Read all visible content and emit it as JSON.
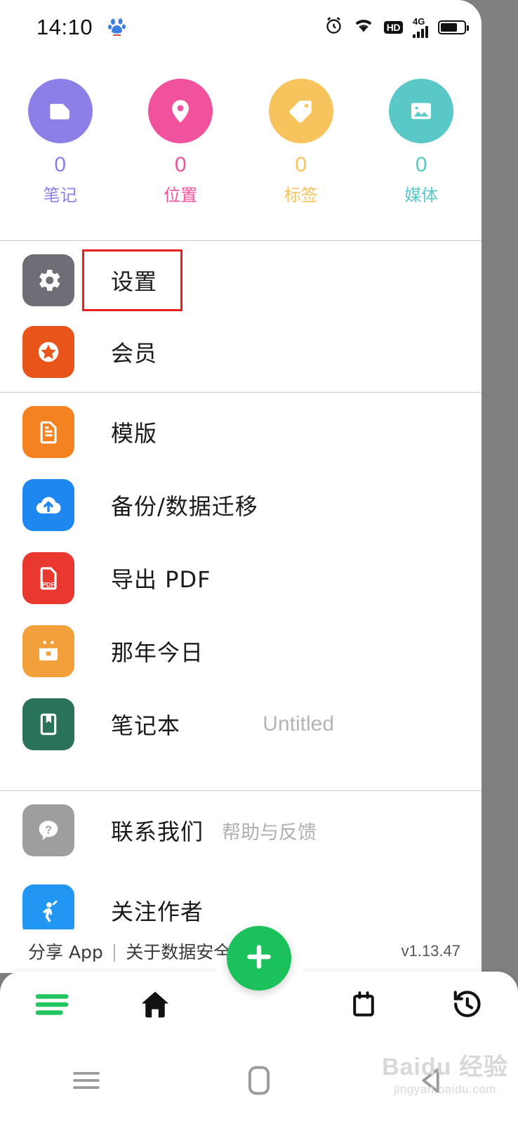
{
  "status_bar": {
    "time": "14:10",
    "paw_icon": "baidu-paw-icon",
    "alarm_icon": "alarm-clock-icon",
    "wifi_icon": "wifi-icon",
    "hd_label": "HD",
    "network_label": "4G",
    "battery_icon": "battery-icon"
  },
  "stats": [
    {
      "count": "0",
      "label": "笔记",
      "icon": "note-document-icon",
      "color": "#8C7FE8"
    },
    {
      "count": "0",
      "label": "位置",
      "icon": "location-pin-icon",
      "color": "#F0529E"
    },
    {
      "count": "0",
      "label": "标签",
      "icon": "tag-icon",
      "color": "#F7C35C"
    },
    {
      "count": "0",
      "label": "媒体",
      "icon": "image-media-icon",
      "color": "#5BC8C8"
    }
  ],
  "menu_groups": [
    {
      "items": [
        {
          "label": "设置",
          "icon": "gear-icon",
          "color": "#6E6E76",
          "highlighted": true
        },
        {
          "label": "会员",
          "icon": "star-badge-icon",
          "color": "#E8551B"
        }
      ]
    },
    {
      "items": [
        {
          "label": "模版",
          "icon": "template-document-icon",
          "color": "#F58220"
        },
        {
          "label": "备份/数据迁移",
          "icon": "cloud-upload-icon",
          "color": "#1E88F0"
        },
        {
          "label": "导出 PDF",
          "icon": "pdf-file-icon",
          "color": "#E8382F"
        },
        {
          "label": "那年今日",
          "icon": "calendar-icon",
          "color": "#F2A03C"
        },
        {
          "label": "笔记本",
          "icon": "notebook-icon",
          "color": "#2A7259",
          "value": "Untitled"
        }
      ]
    },
    {
      "items": [
        {
          "label": "联系我们",
          "sub": "帮助与反馈",
          "icon": "question-help-icon",
          "color": "#9E9E9E"
        },
        {
          "label": "关注作者",
          "icon": "person-wave-icon",
          "color": "#2196F3"
        }
      ]
    }
  ],
  "footer": {
    "share_app": "分享 App",
    "separator": "|",
    "data_safety": "关于数据安全",
    "version": "v1.13.47"
  },
  "bottom_nav": {
    "items": [
      {
        "icon": "menu-list-icon",
        "active": true
      },
      {
        "icon": "home-icon",
        "active": false
      },
      {
        "icon": "calendar-icon",
        "active": false
      },
      {
        "icon": "history-icon",
        "active": false
      }
    ],
    "fab": {
      "icon": "plus-icon",
      "color": "#1BC15A"
    }
  },
  "system_nav": {
    "recents_icon": "recents-icon",
    "home_icon": "home-square-icon",
    "back_icon": "back-triangle-icon"
  },
  "watermark": {
    "main": "Baidu 经验",
    "sub": "jingyan.baidu.com"
  }
}
